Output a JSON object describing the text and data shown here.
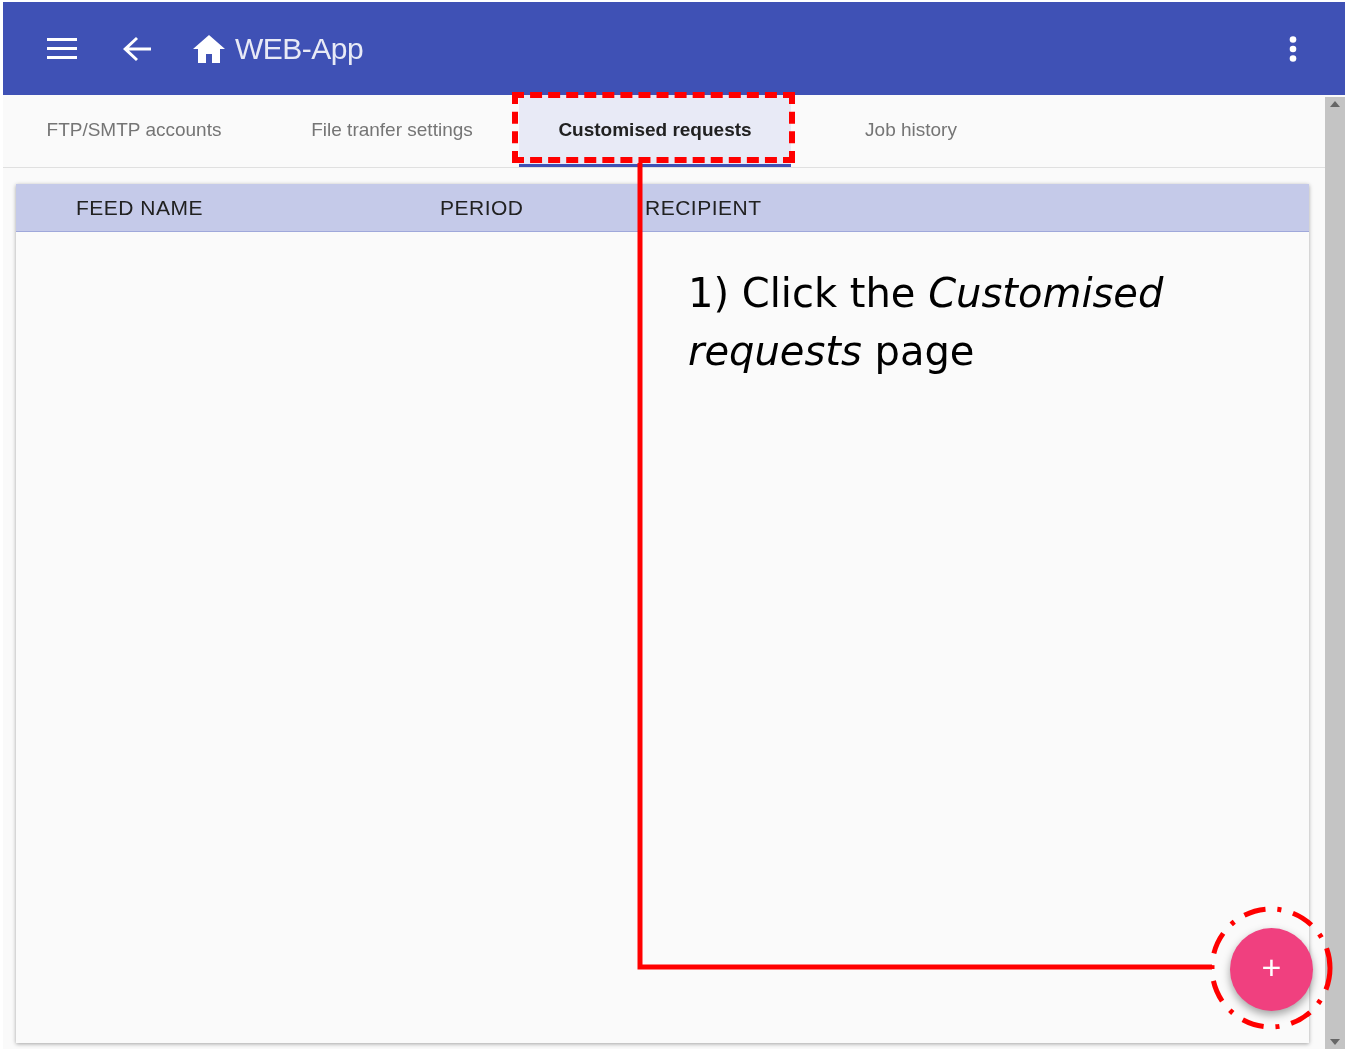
{
  "app_bar": {
    "title": "WEB-App"
  },
  "tabs": [
    {
      "label": "FTP/SMTP accounts",
      "selected": false
    },
    {
      "label": "File tranfer settings",
      "selected": false
    },
    {
      "label": "Customised requests",
      "selected": true
    },
    {
      "label": "Job history",
      "selected": false
    }
  ],
  "table": {
    "columns": [
      "FEED NAME",
      "PERIOD",
      "RECIPIENT"
    ]
  },
  "fab": {
    "label": "+"
  },
  "annotation": {
    "text": "1) Click the *Customised requests* page"
  }
}
